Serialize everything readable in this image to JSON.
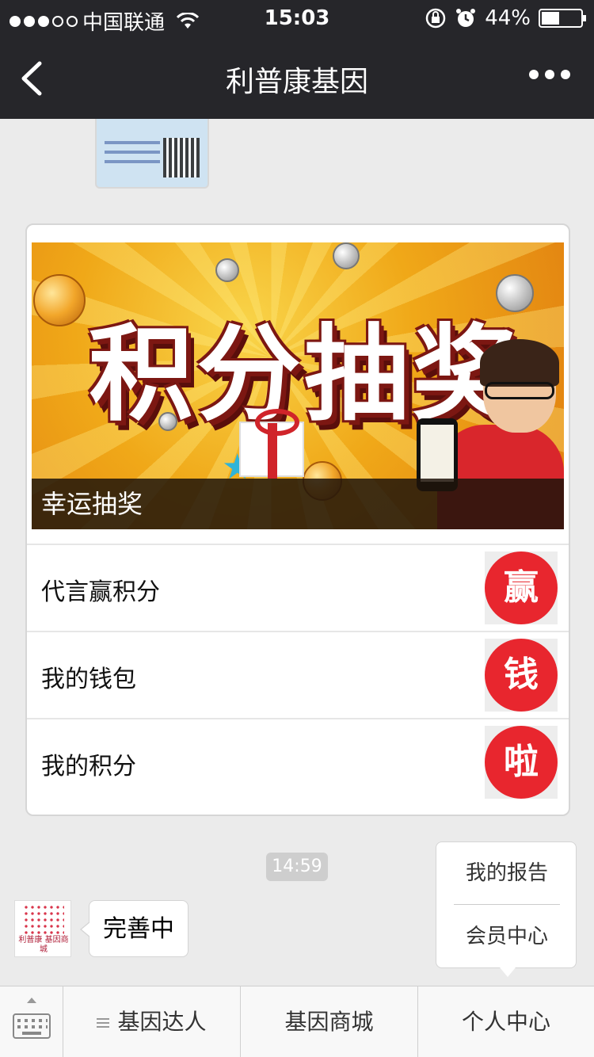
{
  "status_bar": {
    "carrier": "中国联通",
    "time": "15:03",
    "battery": "44%"
  },
  "nav": {
    "title": "利普康基因"
  },
  "card": {
    "banner_text": "积分抽奖",
    "banner_caption": "幸运抽奖",
    "items": [
      {
        "label": "代言赢积分",
        "badge": "赢"
      },
      {
        "label": "我的钱包",
        "badge": "钱"
      },
      {
        "label": "我的积分",
        "badge": "啦"
      }
    ]
  },
  "chat": {
    "timestamp": "14:59",
    "message": "完善中",
    "avatar_logo_text": "利普康 基因商城"
  },
  "popup_menu": {
    "items": [
      "我的报告",
      "会员中心"
    ]
  },
  "tab_bar": {
    "tabs": [
      "基因达人",
      "基因商城",
      "个人中心"
    ]
  },
  "colors": {
    "nav_bg": "#26262a",
    "badge_red": "#e8262e",
    "page_bg": "#ebebeb"
  }
}
